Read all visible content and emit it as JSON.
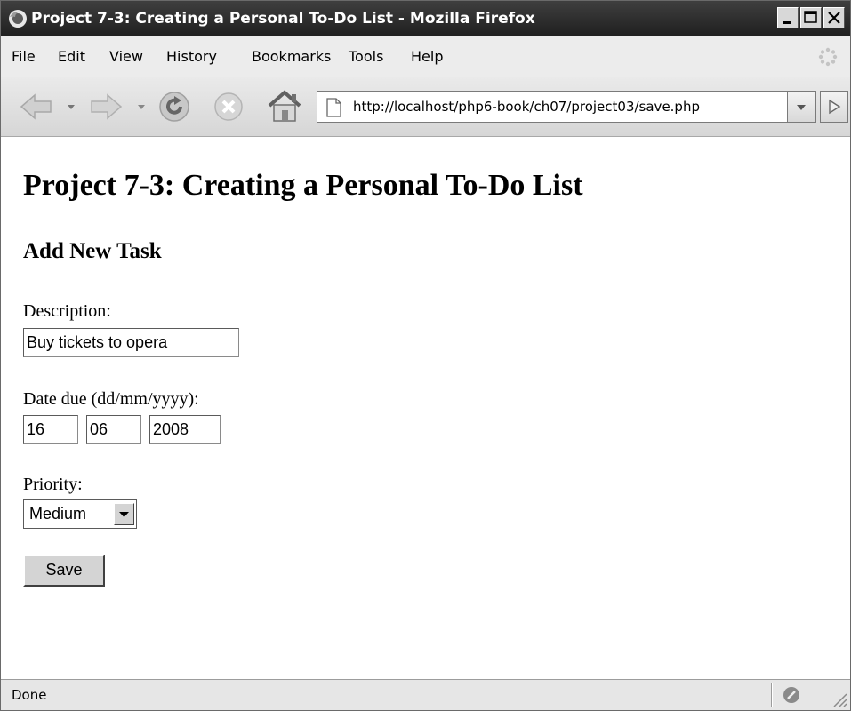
{
  "window": {
    "title": "Project 7-3: Creating a Personal To-Do List - Mozilla Firefox"
  },
  "menu": {
    "items": [
      "File",
      "Edit",
      "View",
      "History",
      "Bookmarks",
      "Tools",
      "Help"
    ]
  },
  "navbar": {
    "url": "http://localhost/php6-book/ch07/project03/save.php"
  },
  "page": {
    "title": "Project 7-3: Creating a Personal To-Do List",
    "section_heading": "Add New Task",
    "description_label": "Description:",
    "description_value": "Buy tickets to opera",
    "date_label": "Date due (dd/mm/yyyy):",
    "date_day": "16",
    "date_month": "06",
    "date_year": "2008",
    "priority_label": "Priority:",
    "priority_value": "Medium",
    "save_label": "Save"
  },
  "status": {
    "text": "Done"
  },
  "icons": {
    "app": "firefox-icon",
    "back": "back-arrow-icon",
    "forward": "forward-arrow-icon",
    "reload": "reload-icon",
    "stop": "stop-icon",
    "home": "home-icon",
    "page": "page-icon",
    "go": "go-arrow-icon",
    "status": "status-icon"
  }
}
